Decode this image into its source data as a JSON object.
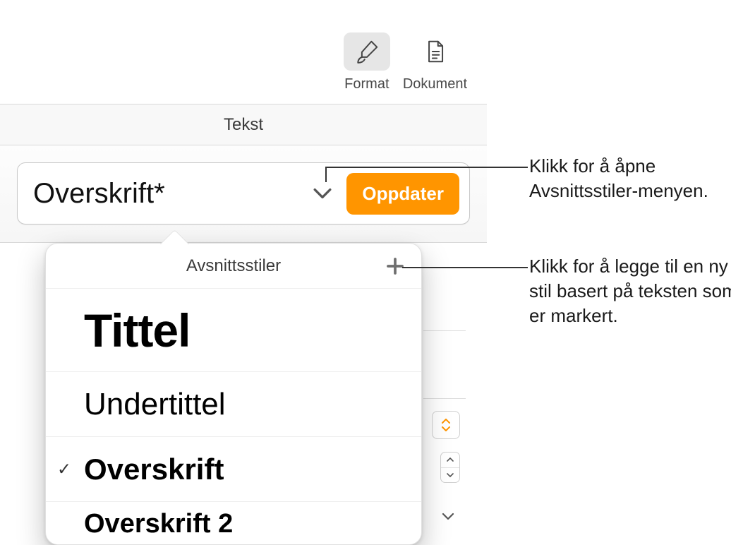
{
  "toolbar": {
    "format_label": "Format",
    "document_label": "Dokument"
  },
  "section": {
    "text_label": "Tekst"
  },
  "style_selector": {
    "current_style": "Overskrift*",
    "update_label": "Oppdater"
  },
  "popover": {
    "title": "Avsnittsstiler",
    "styles": [
      {
        "label": "Tittel",
        "selected": false
      },
      {
        "label": "Undertittel",
        "selected": false
      },
      {
        "label": "Overskrift",
        "selected": true
      },
      {
        "label": "Overskrift 2",
        "selected": false
      }
    ]
  },
  "callouts": {
    "open_menu": "Klikk for å åpne Avsnittsstiler-menyen.",
    "add_style": "Klikk for å legge til en ny stil basert på teksten som er markert."
  }
}
